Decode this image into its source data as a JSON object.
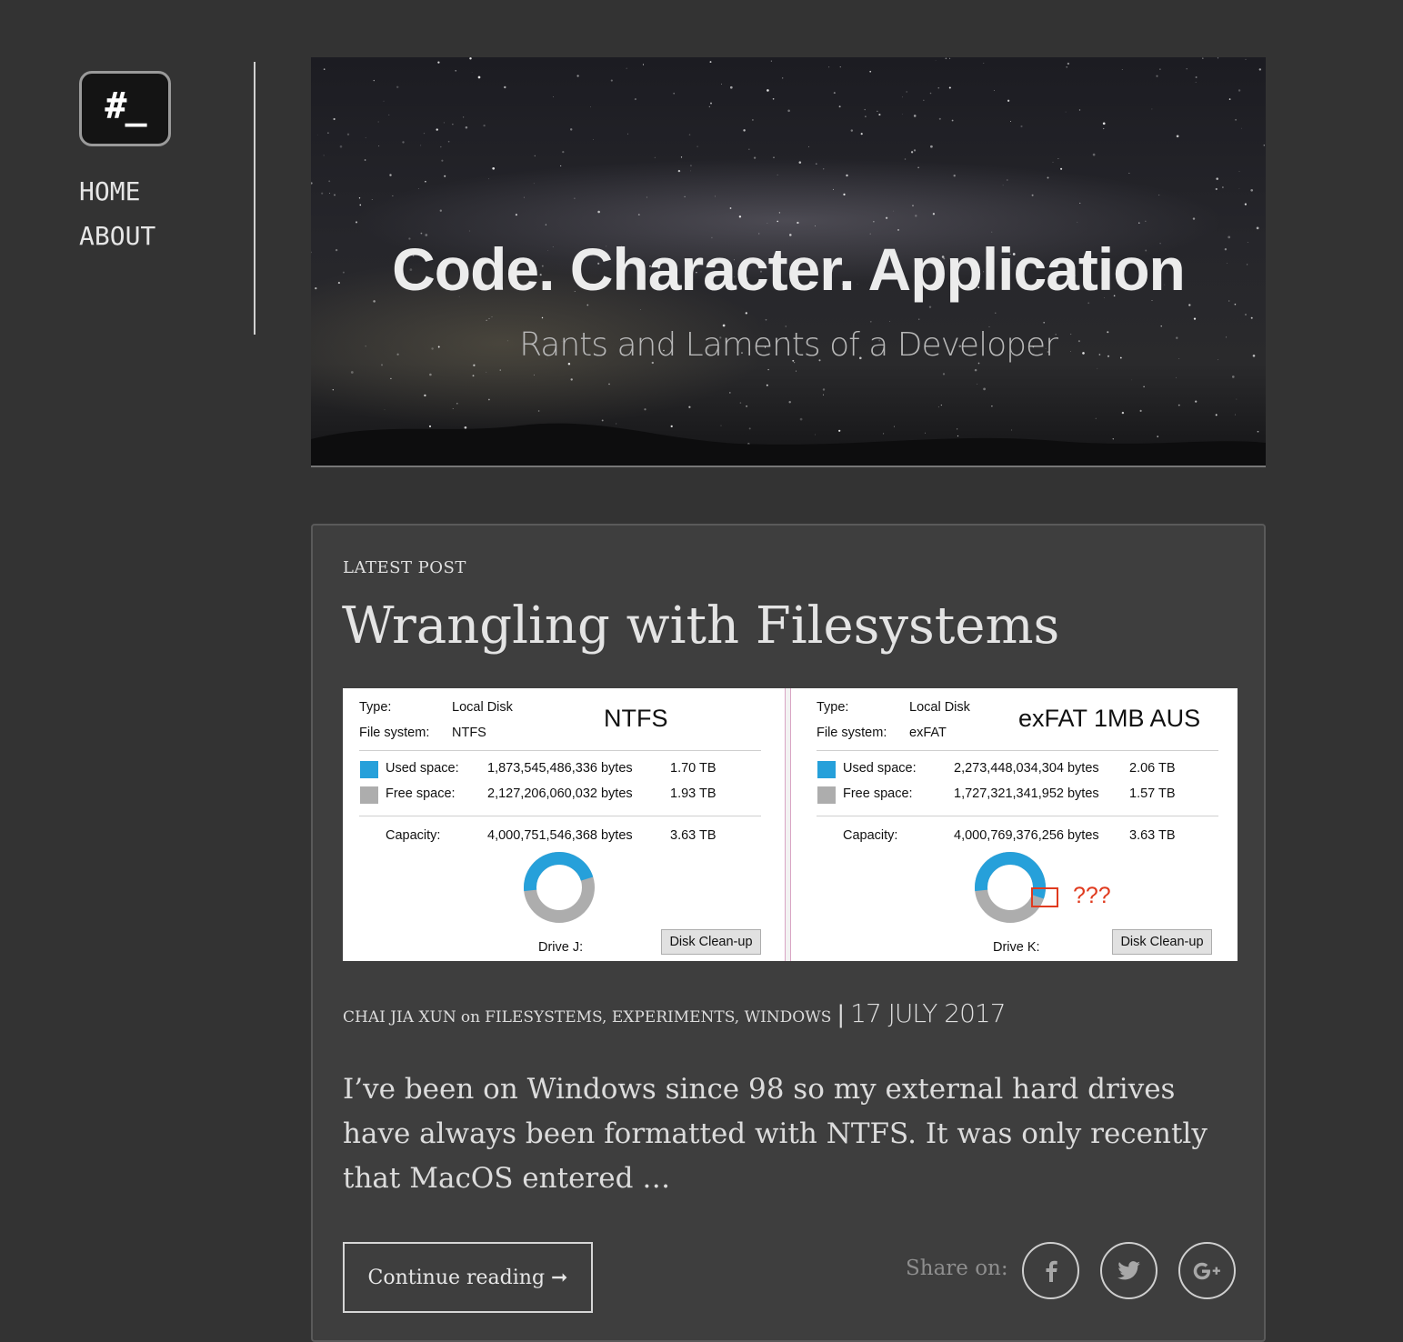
{
  "sidebar": {
    "logo_text": "#_",
    "nav": [
      {
        "label": "HOME"
      },
      {
        "label": "ABOUT"
      }
    ]
  },
  "banner": {
    "title": "Code. Character. Application",
    "subtitle": "Rants and Laments of a Developer"
  },
  "post": {
    "kicker": "LATEST POST",
    "title": "Wrangling with Filesystems",
    "image": {
      "left": {
        "label": "NTFS",
        "type_label": "Type:",
        "type_value": "Local Disk",
        "fs_label": "File system:",
        "fs_value": "NTFS",
        "used_label": "Used space:",
        "used_bytes": "1,873,545,486,336 bytes",
        "used_tb": "1.70 TB",
        "free_label": "Free space:",
        "free_bytes": "2,127,206,060,032 bytes",
        "free_tb": "1.93 TB",
        "cap_label": "Capacity:",
        "cap_bytes": "4,000,751,546,368 bytes",
        "cap_tb": "3.63 TB",
        "drive": "Drive J:",
        "cleanup": "Disk Clean-up",
        "used_fraction": 0.468
      },
      "right": {
        "label": "exFAT 1MB AUS",
        "type_label": "Type:",
        "type_value": "Local Disk",
        "fs_label": "File system:",
        "fs_value": "exFAT",
        "used_label": "Used space:",
        "used_bytes": "2,273,448,034,304 bytes",
        "used_tb": "2.06 TB",
        "free_label": "Free space:",
        "free_bytes": "1,727,321,341,952 bytes",
        "free_tb": "1.57 TB",
        "cap_label": "Capacity:",
        "cap_bytes": "4,000,769,376,256 bytes",
        "cap_tb": "3.63 TB",
        "drive": "Drive K:",
        "cleanup": "Disk Clean-up",
        "annotation": "???",
        "used_fraction": 0.568
      },
      "colors": {
        "used": "#26a0da",
        "free": "#adadad",
        "annotation": "#e03a1e"
      }
    },
    "meta": {
      "author": "CHAI JIA XUN",
      "on": "on",
      "tags": "FILESYSTEMS, EXPERIMENTS, WINDOWS",
      "separator": "|",
      "date": "17 JULY 2017"
    },
    "excerpt": "I’ve been on Windows since 98 so my external hard drives have always been formatted with NTFS. It was only recently that MacOS entered …",
    "continue_label": "Continue reading ➞",
    "share": {
      "label": "Share on:",
      "icons": [
        "facebook-icon",
        "twitter-icon",
        "google-plus-icon"
      ]
    }
  }
}
